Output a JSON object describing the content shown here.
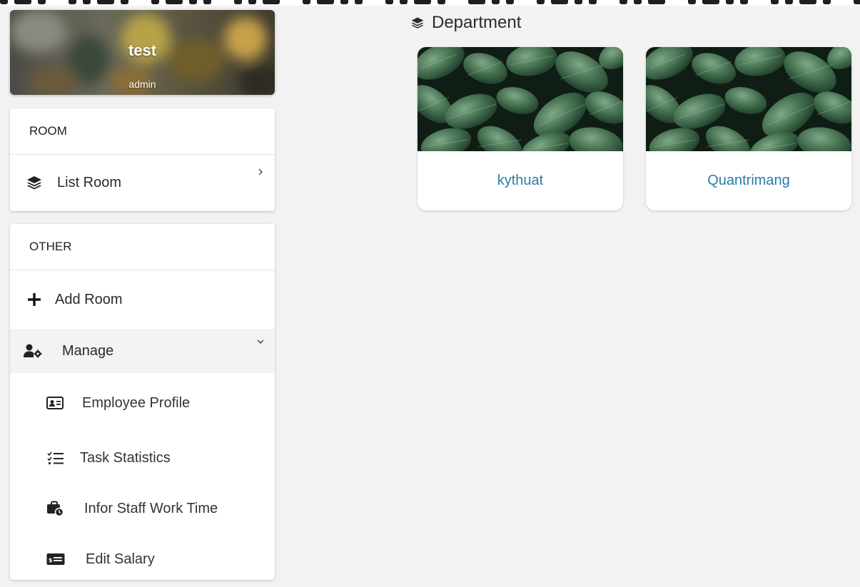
{
  "profile": {
    "name": "test",
    "role": "admin"
  },
  "sidebar": {
    "room_section": {
      "header": "ROOM",
      "items": [
        {
          "label": "List Room",
          "icon": "layers-icon"
        }
      ]
    },
    "other_section": {
      "header": "OTHER",
      "items": [
        {
          "label": "Add Room",
          "icon": "plus-icon"
        },
        {
          "label": "Manage",
          "icon": "users-cog-icon",
          "expanded": true
        }
      ],
      "manage_subitems": [
        {
          "label": "Employee Profile",
          "icon": "id-card-icon"
        },
        {
          "label": "Task Statistics",
          "icon": "task-list-icon"
        },
        {
          "label": "Infor Staff Work Time",
          "icon": "briefcase-clock-icon"
        },
        {
          "label": "Edit Salary",
          "icon": "money-check-icon"
        }
      ]
    }
  },
  "main": {
    "title": "Department",
    "title_icon": "layers-icon",
    "departments": [
      {
        "name": "kythuat"
      },
      {
        "name": "Quantrimang"
      }
    ]
  },
  "colors": {
    "accent_link": "#2b7ca6",
    "background": "#f2f2f2",
    "active_item": "#f3f3f3"
  }
}
